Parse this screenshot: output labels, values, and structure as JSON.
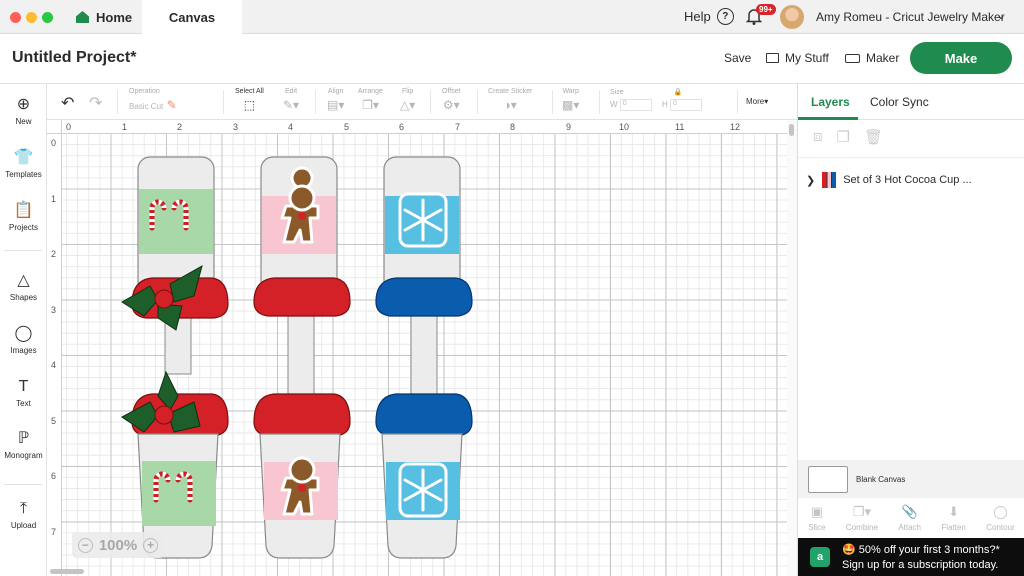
{
  "window": {
    "tabs": [
      {
        "label": "Home"
      },
      {
        "label": "Canvas"
      }
    ],
    "help_label": "Help",
    "notifications_badge": "99+",
    "user_name": "Amy Romeu - Cricut Jewelry Maker"
  },
  "header": {
    "project_title": "Untitled Project*",
    "save_label": "Save",
    "mystuff_label": "My Stuff",
    "machine_label": "Maker",
    "make_label": "Make",
    "brand_color": "#1f8b4f"
  },
  "leftnav": [
    {
      "label": "New",
      "icon": "plus-circle-icon"
    },
    {
      "label": "Templates",
      "icon": "shirt-icon"
    },
    {
      "label": "Projects",
      "icon": "clipboard-icon"
    },
    {
      "label": "Shapes",
      "icon": "shapes-icon"
    },
    {
      "label": "Images",
      "icon": "bulb-icon"
    },
    {
      "label": "Text",
      "icon": "text-icon"
    },
    {
      "label": "Monogram",
      "icon": "monogram-icon"
    },
    {
      "label": "Upload",
      "icon": "upload-icon"
    }
  ],
  "toolbar": {
    "operation_label": "Operation",
    "operation_value": "Basic Cut",
    "select_all_label": "Select All",
    "edit_label": "Edit",
    "align_label": "Align",
    "arrange_label": "Arrange",
    "flip_label": "Flip",
    "offset_label": "Offset",
    "create_sticker_label": "Create Sticker",
    "warp_label": "Warp",
    "size_label": "Size",
    "w_label": "W",
    "h_label": "H",
    "w_value": "0",
    "h_value": "0",
    "more_label": "More"
  },
  "ruler": {
    "h_ticks": [
      "0",
      "1",
      "2",
      "3",
      "4",
      "5",
      "6",
      "7",
      "8",
      "9",
      "10",
      "11",
      "12"
    ],
    "v_ticks": [
      "0",
      "1",
      "2",
      "3",
      "4",
      "5",
      "6",
      "7"
    ]
  },
  "canvas": {
    "zoom": "100%",
    "colors": {
      "red": "#d42027",
      "blue": "#0a5cad",
      "green": "#a8d8a8",
      "pink": "#f7c6d0",
      "light_blue": "#57bfe2",
      "cup": "#ececec"
    }
  },
  "right_panel": {
    "tab_layers": "Layers",
    "tab_color_sync": "Color Sync",
    "layer_name": "Set of 3 Hot Cocoa Cup ...",
    "blank_canvas_label": "Blank Canvas",
    "bottom_tools": [
      "Slice",
      "Combine",
      "Attach",
      "Flatten",
      "Contour"
    ]
  },
  "promo": {
    "line1": "🤩 50% off your first 3 months?*",
    "line2": "Sign up for a subscription today."
  }
}
